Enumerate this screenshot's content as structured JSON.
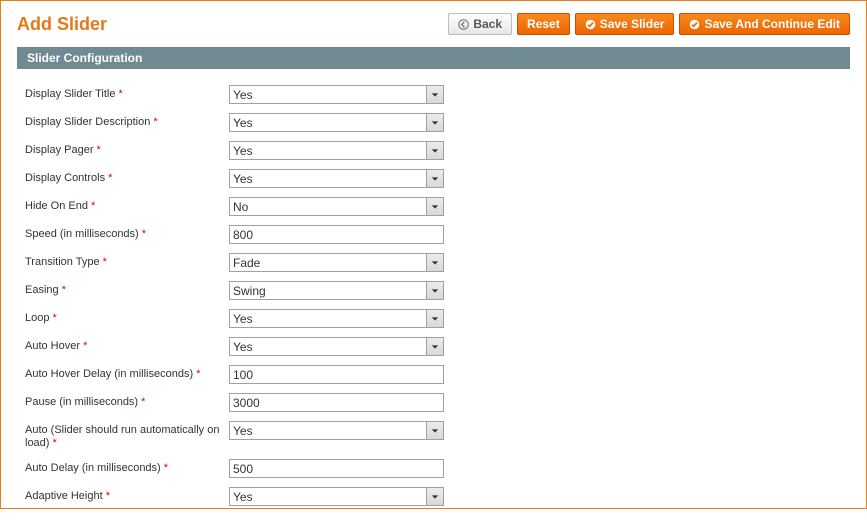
{
  "header": {
    "title": "Add Slider",
    "buttons": {
      "back": "Back",
      "reset": "Reset",
      "save": "Save Slider",
      "save_continue": "Save And Continue Edit"
    }
  },
  "section": {
    "title": "Slider Configuration"
  },
  "fields": {
    "display_title": {
      "label": "Display Slider Title",
      "value": "Yes"
    },
    "display_desc": {
      "label": "Display Slider Description",
      "value": "Yes"
    },
    "display_pager": {
      "label": "Display Pager",
      "value": "Yes"
    },
    "display_controls": {
      "label": "Display Controls",
      "value": "Yes"
    },
    "hide_on_end": {
      "label": "Hide On End",
      "value": "No"
    },
    "speed": {
      "label": "Speed (in milliseconds)",
      "value": "800"
    },
    "transition": {
      "label": "Transition Type",
      "value": "Fade"
    },
    "easing": {
      "label": "Easing",
      "value": "Swing"
    },
    "loop": {
      "label": "Loop",
      "value": "Yes"
    },
    "auto_hover": {
      "label": "Auto Hover",
      "value": "Yes"
    },
    "auto_hover_delay": {
      "label": "Auto Hover Delay (in milliseconds)",
      "value": "100"
    },
    "pause": {
      "label": "Pause (in milliseconds)",
      "value": "3000"
    },
    "auto_run": {
      "label": "Auto (Slider should run automatically on load)",
      "value": "Yes"
    },
    "auto_delay": {
      "label": "Auto Delay (in milliseconds)",
      "value": "500"
    },
    "adaptive_height": {
      "label": "Adaptive Height",
      "value": "Yes"
    }
  },
  "required_marker": " *"
}
